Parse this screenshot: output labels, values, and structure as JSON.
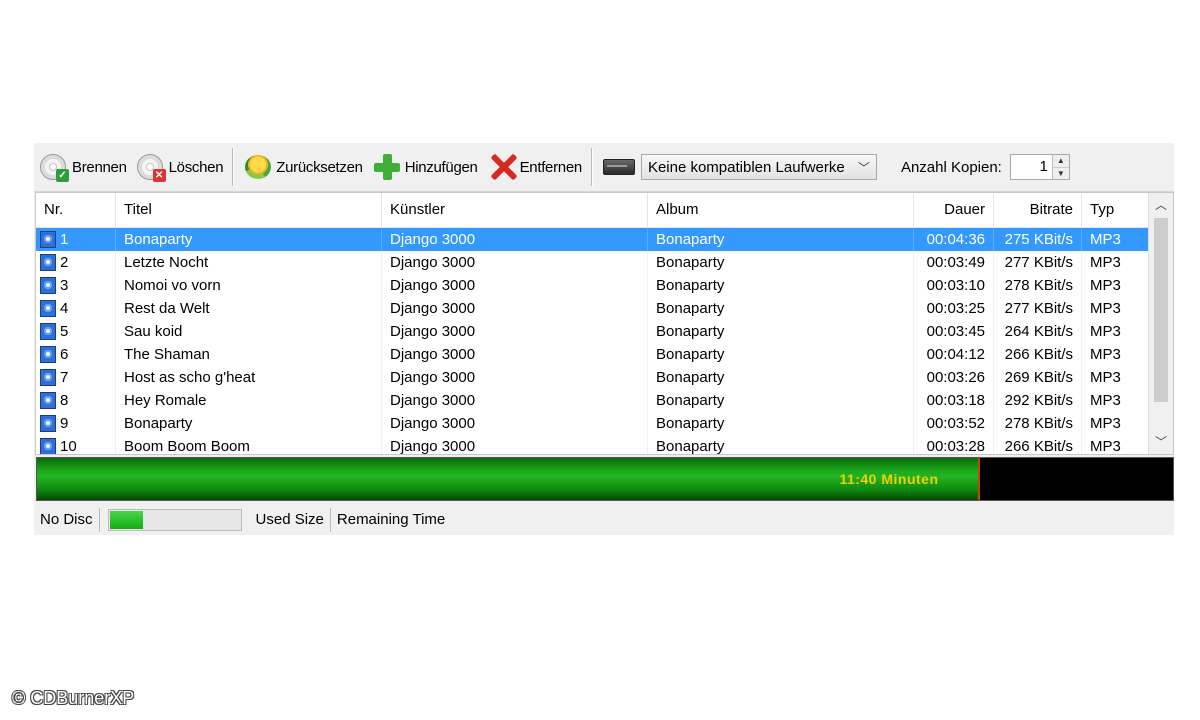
{
  "toolbar": {
    "burn_label": "Brennen",
    "delete_label": "Löschen",
    "reset_label": "Zurücksetzen",
    "add_label": "Hinzufügen",
    "remove_label": "Entfernen",
    "drive_select": "Keine kompatiblen Laufwerke",
    "copies_label": "Anzahl Kopien:",
    "copies_value": "1"
  },
  "table": {
    "headers": {
      "nr": "Nr.",
      "title": "Titel",
      "artist": "Künstler",
      "album": "Album",
      "duration": "Dauer",
      "bitrate": "Bitrate",
      "type": "Typ"
    },
    "rows": [
      {
        "nr": "1",
        "title": "Bonaparty",
        "artist": "Django 3000",
        "album": "Bonaparty",
        "duration": "00:04:36",
        "bitrate": "275 KBit/s",
        "type": "MP3",
        "selected": true
      },
      {
        "nr": "2",
        "title": "Letzte Nocht",
        "artist": "Django 3000",
        "album": "Bonaparty",
        "duration": "00:03:49",
        "bitrate": "277 KBit/s",
        "type": "MP3"
      },
      {
        "nr": "3",
        "title": "Nomoi vo vorn",
        "artist": "Django 3000",
        "album": "Bonaparty",
        "duration": "00:03:10",
        "bitrate": "278 KBit/s",
        "type": "MP3"
      },
      {
        "nr": "4",
        "title": "Rest da Welt",
        "artist": "Django 3000",
        "album": "Bonaparty",
        "duration": "00:03:25",
        "bitrate": "277 KBit/s",
        "type": "MP3"
      },
      {
        "nr": "5",
        "title": "Sau koid",
        "artist": "Django 3000",
        "album": "Bonaparty",
        "duration": "00:03:45",
        "bitrate": "264 KBit/s",
        "type": "MP3"
      },
      {
        "nr": "6",
        "title": "The Shaman",
        "artist": "Django 3000",
        "album": "Bonaparty",
        "duration": "00:04:12",
        "bitrate": "266 KBit/s",
        "type": "MP3"
      },
      {
        "nr": "7",
        "title": "Host as scho g'heat",
        "artist": "Django 3000",
        "album": "Bonaparty",
        "duration": "00:03:26",
        "bitrate": "269 KBit/s",
        "type": "MP3"
      },
      {
        "nr": "8",
        "title": "Hey Romale",
        "artist": "Django 3000",
        "album": "Bonaparty",
        "duration": "00:03:18",
        "bitrate": "292 KBit/s",
        "type": "MP3"
      },
      {
        "nr": "9",
        "title": "Bonaparty",
        "artist": "Django 3000",
        "album": "Bonaparty",
        "duration": "00:03:52",
        "bitrate": "278 KBit/s",
        "type": "MP3"
      },
      {
        "nr": "10",
        "title": "Boom Boom Boom",
        "artist": "Django 3000",
        "album": "Bonaparty",
        "duration": "00:03:28",
        "bitrate": "266 KBit/s",
        "type": "MP3"
      }
    ]
  },
  "capacity": {
    "text": "11:40 Minuten",
    "fill_fraction": 0.828
  },
  "status": {
    "disc": "No Disc",
    "used_fraction": 0.25,
    "used_size": "Used Size",
    "remaining_time": "Remaining Time"
  },
  "copyright": "© CDBurnerXP",
  "icons": {
    "burn": "disc-burn-icon",
    "delete": "disc-delete-icon",
    "reset": "reset-icon",
    "add": "plus-icon",
    "remove": "x-icon",
    "drive": "drive-icon",
    "track": "audio-track-icon"
  },
  "colors": {
    "selection": "#3399ff",
    "capacity_fill": "#1ca81c",
    "capacity_text": "#f0d000",
    "capacity_empty": "#000000"
  }
}
